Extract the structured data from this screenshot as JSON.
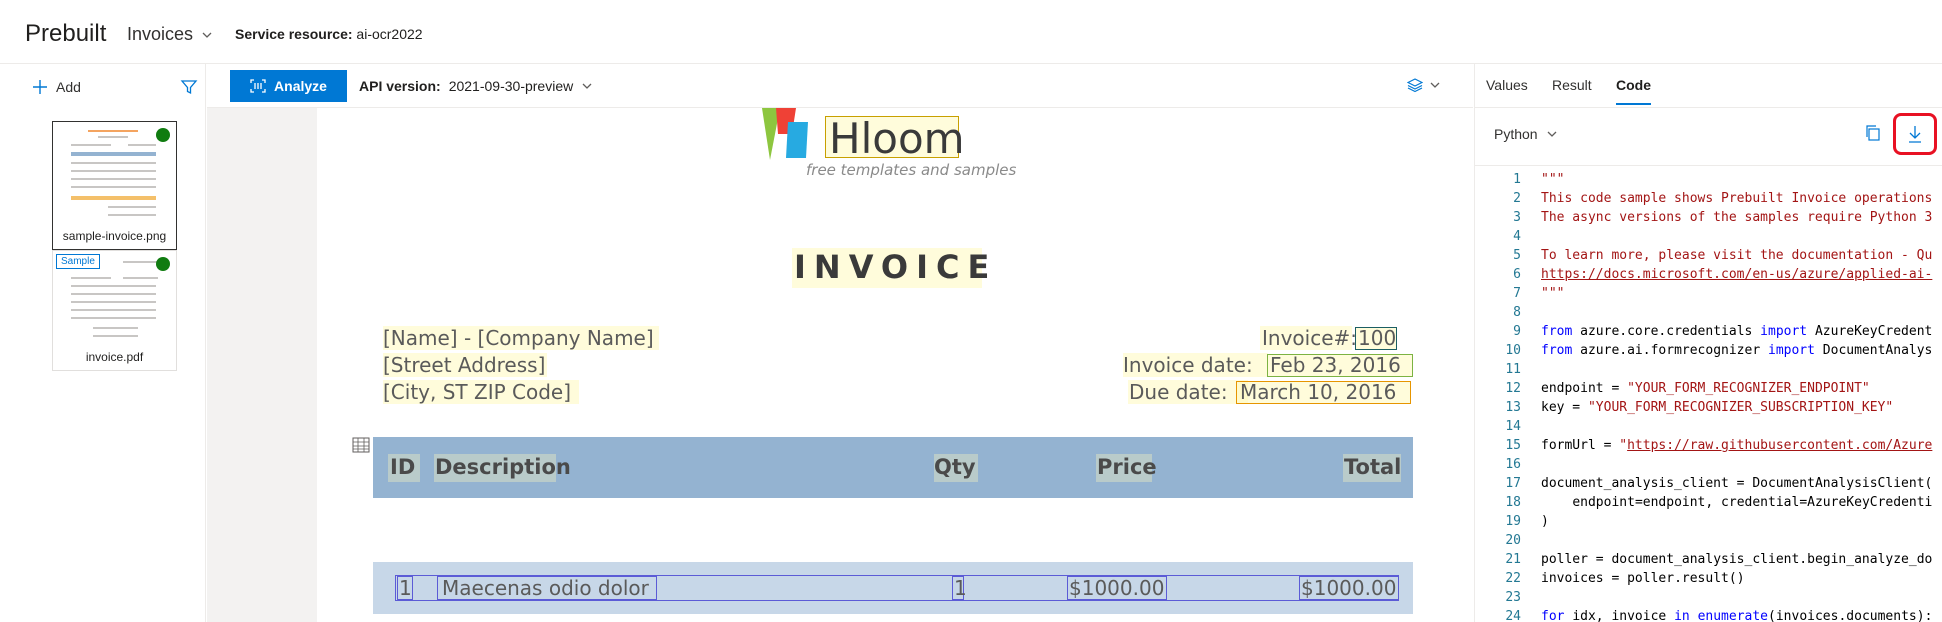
{
  "header": {
    "brand": "Prebuilt",
    "model": "Invoices",
    "service_label": "Service resource:",
    "service_value": "ai-ocr2022"
  },
  "sidebar": {
    "add_label": "Add",
    "files": [
      {
        "name": "sample-invoice.png",
        "status": "analyzed",
        "selected": true
      },
      {
        "name": "invoice.pdf",
        "status": "analyzed",
        "badge": "Sample"
      }
    ]
  },
  "toolbar": {
    "analyze_label": "Analyze",
    "api_label": "API version:",
    "api_value": "2021-09-30-preview"
  },
  "document": {
    "logo_text": "Hloom",
    "logo_tagline": "free templates and samples",
    "title": "INVOICE",
    "from": [
      "[Name] - [Company Name]",
      "[Street Address]",
      "[City, ST ZIP Code]"
    ],
    "invoice_no_label": "Invoice#:",
    "invoice_no_value": "100",
    "invoice_date_label": "Invoice date:",
    "invoice_date_value": "Feb 23, 2016",
    "due_date_label": "Due date:",
    "due_date_value": "March 10, 2016",
    "table_headers": [
      "ID",
      "Description",
      "Qty",
      "Price",
      "Total"
    ],
    "table_rows": [
      [
        "1",
        "Maecenas odio dolor",
        "1",
        "$1000.00",
        "$1000.00"
      ]
    ]
  },
  "right_panel": {
    "tabs": [
      "Values",
      "Result",
      "Code"
    ],
    "active_tab": "Code",
    "language": "Python",
    "code_lines": [
      "\"\"\"",
      "This code sample shows Prebuilt Invoice operations",
      "The async versions of the samples require Python 3",
      "",
      "To learn more, please visit the documentation - Qu",
      "https://docs.microsoft.com/en-us/azure/applied-ai-",
      "\"\"\"",
      "",
      "from azure.core.credentials import AzureKeyCredent",
      "from azure.ai.formrecognizer import DocumentAnalys",
      "",
      "endpoint = \"YOUR_FORM_RECOGNIZER_ENDPOINT\"",
      "key = \"YOUR_FORM_RECOGNIZER_SUBSCRIPTION_KEY\"",
      "",
      "formUrl = \"https://raw.githubusercontent.com/Azure",
      "",
      "document_analysis_client = DocumentAnalysisClient(",
      "    endpoint=endpoint, credential=AzureKeyCredenti",
      ")",
      "",
      "poller = document_analysis_client.begin_analyze_do",
      "invoices = poller.result()",
      "",
      "for idx, invoice in enumerate(invoices.documents):"
    ],
    "line_numbers": [
      "1",
      "2",
      "3",
      "4",
      "5",
      "6",
      "7",
      "8",
      "9",
      "10",
      "11",
      "12",
      "13",
      "14",
      "15",
      "16",
      "17",
      "18",
      "19",
      "20",
      "21",
      "22",
      "23",
      "24"
    ]
  },
  "colors": {
    "accent": "#0078d4",
    "status_ok": "#107c10",
    "highlight_red": "#e81123",
    "table_header_bg": "#94b3d1"
  }
}
